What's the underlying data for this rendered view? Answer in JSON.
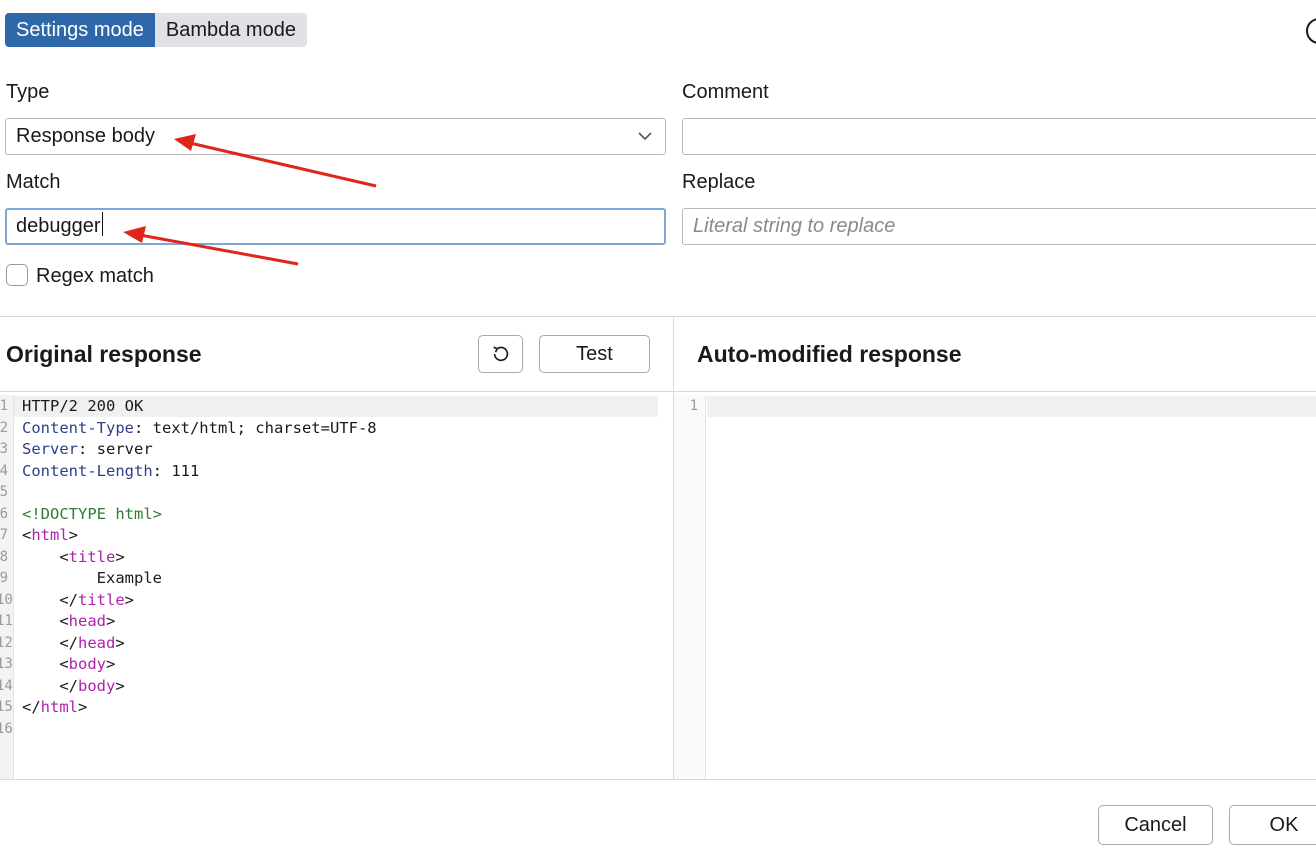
{
  "modes": {
    "settings": "Settings mode",
    "bambda": "Bambda mode",
    "active": "settings"
  },
  "form": {
    "type_label": "Type",
    "type_value": "Response body",
    "comment_label": "Comment",
    "comment_value": "",
    "match_label": "Match",
    "match_value": "debugger",
    "replace_label": "Replace",
    "replace_placeholder": "Literal string to replace",
    "regex_label": "Regex match",
    "regex_checked": false
  },
  "original": {
    "title": "Original response",
    "test_label": "Test",
    "line_numbers": [
      "1",
      "2",
      "3",
      "4",
      "5",
      "6",
      "7",
      "8",
      "9",
      "10",
      "11",
      "12",
      "13",
      "14",
      "15",
      "16"
    ],
    "lines": [
      {
        "parts": [
          {
            "t": "HTTP/2 200 OK",
            "c": ""
          }
        ]
      },
      {
        "parts": [
          {
            "t": "Content-Type",
            "c": "hdr-key"
          },
          {
            "t": ": text/html; charset=UTF-8",
            "c": ""
          }
        ]
      },
      {
        "parts": [
          {
            "t": "Server",
            "c": "hdr-key"
          },
          {
            "t": ": server",
            "c": ""
          }
        ]
      },
      {
        "parts": [
          {
            "t": "Content-Length",
            "c": "hdr-key"
          },
          {
            "t": ": 111",
            "c": ""
          }
        ]
      },
      {
        "parts": [
          {
            "t": "",
            "c": ""
          }
        ]
      },
      {
        "parts": [
          {
            "t": "<!DOCTYPE html>",
            "c": "doctype"
          }
        ]
      },
      {
        "parts": [
          {
            "t": "<",
            "c": ""
          },
          {
            "t": "html",
            "c": "tag"
          },
          {
            "t": ">",
            "c": ""
          }
        ]
      },
      {
        "parts": [
          {
            "t": "    <",
            "c": ""
          },
          {
            "t": "title",
            "c": "tag"
          },
          {
            "t": ">",
            "c": ""
          }
        ]
      },
      {
        "parts": [
          {
            "t": "        Example",
            "c": ""
          }
        ]
      },
      {
        "parts": [
          {
            "t": "    </",
            "c": ""
          },
          {
            "t": "title",
            "c": "tag"
          },
          {
            "t": ">",
            "c": ""
          }
        ]
      },
      {
        "parts": [
          {
            "t": "    <",
            "c": ""
          },
          {
            "t": "head",
            "c": "tag"
          },
          {
            "t": ">",
            "c": ""
          }
        ]
      },
      {
        "parts": [
          {
            "t": "    </",
            "c": ""
          },
          {
            "t": "head",
            "c": "tag"
          },
          {
            "t": ">",
            "c": ""
          }
        ]
      },
      {
        "parts": [
          {
            "t": "    <",
            "c": ""
          },
          {
            "t": "body",
            "c": "tag"
          },
          {
            "t": ">",
            "c": ""
          }
        ]
      },
      {
        "parts": [
          {
            "t": "    </",
            "c": ""
          },
          {
            "t": "body",
            "c": "tag"
          },
          {
            "t": ">",
            "c": ""
          }
        ]
      },
      {
        "parts": [
          {
            "t": "</",
            "c": ""
          },
          {
            "t": "html",
            "c": "tag"
          },
          {
            "t": ">",
            "c": ""
          }
        ]
      },
      {
        "parts": [
          {
            "t": "",
            "c": ""
          }
        ]
      }
    ]
  },
  "modified": {
    "title": "Auto-modified response",
    "line_numbers": [
      "1"
    ]
  },
  "footer": {
    "cancel": "Cancel",
    "ok": "OK"
  },
  "colors": {
    "accent": "#2f68a8",
    "annotation": "#e0251b",
    "focus": "#7ea7d8"
  },
  "icons": {
    "reset": "reset-icon",
    "dropdown": "chevron-down-icon",
    "help": "help-icon"
  }
}
